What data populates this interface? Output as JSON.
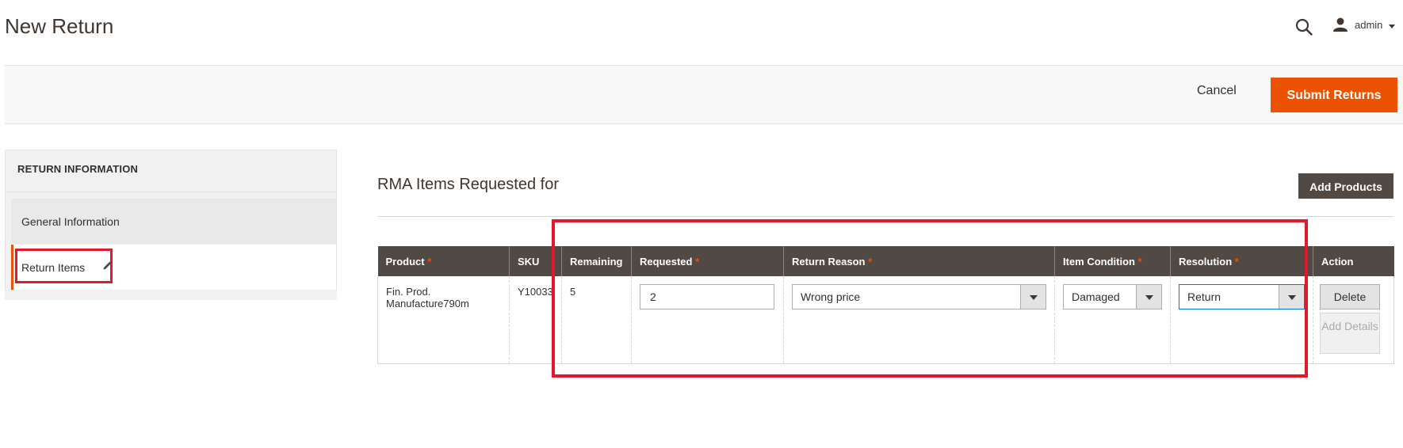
{
  "header": {
    "title": "New Return",
    "user": "admin"
  },
  "action_bar": {
    "cancel_label": "Cancel",
    "submit_label": "Submit Returns"
  },
  "nav": {
    "title": "RETURN INFORMATION",
    "items": [
      {
        "label": "General Information"
      },
      {
        "label": "Return Items"
      }
    ]
  },
  "main": {
    "section_title": "RMA Items Requested for",
    "add_products_label": "Add Products",
    "table": {
      "columns": [
        "Product",
        "SKU",
        "Remaining",
        "Requested",
        "Return Reason",
        "Item Condition",
        "Resolution",
        "Action"
      ],
      "required_marker": "*",
      "row": {
        "product": "Fin. Prod. Manufacture790m",
        "sku": "Y10033",
        "remaining": "5",
        "requested": "2",
        "return_reason": "Wrong price",
        "item_condition": "Damaged",
        "resolution": "Return",
        "delete_label": "Delete",
        "add_details_label": "Add Details"
      }
    }
  },
  "colors": {
    "accent": "#eb5202",
    "table_header": "#514943",
    "highlight": "#e3182d"
  }
}
